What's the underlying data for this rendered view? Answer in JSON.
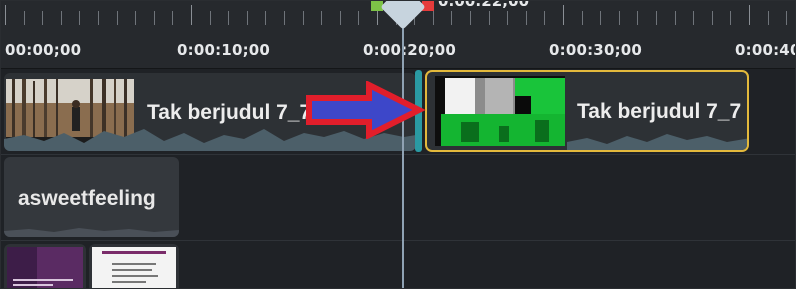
{
  "ruler": {
    "labels": [
      "00:00;00",
      "0:00:10;00",
      "0:00:20;00",
      "0:00:30;00",
      "0:00:40;"
    ]
  },
  "playhead": {
    "time": "0:00:22;00"
  },
  "tracks": {
    "track1": {
      "clip_left_title": "Tak berjudul 7_7",
      "clip_right_title": "Tak berjudul 7_7"
    },
    "track2": {
      "clip_title": "asweetfeeling"
    }
  },
  "colors": {
    "selected_clip_border": "#e3b93c",
    "split_marker": "#2a9aa3",
    "annotation_arrow_fill": "#3d47c9",
    "annotation_arrow_stroke": "#e11e2b",
    "green_screen": "#19c43a"
  }
}
